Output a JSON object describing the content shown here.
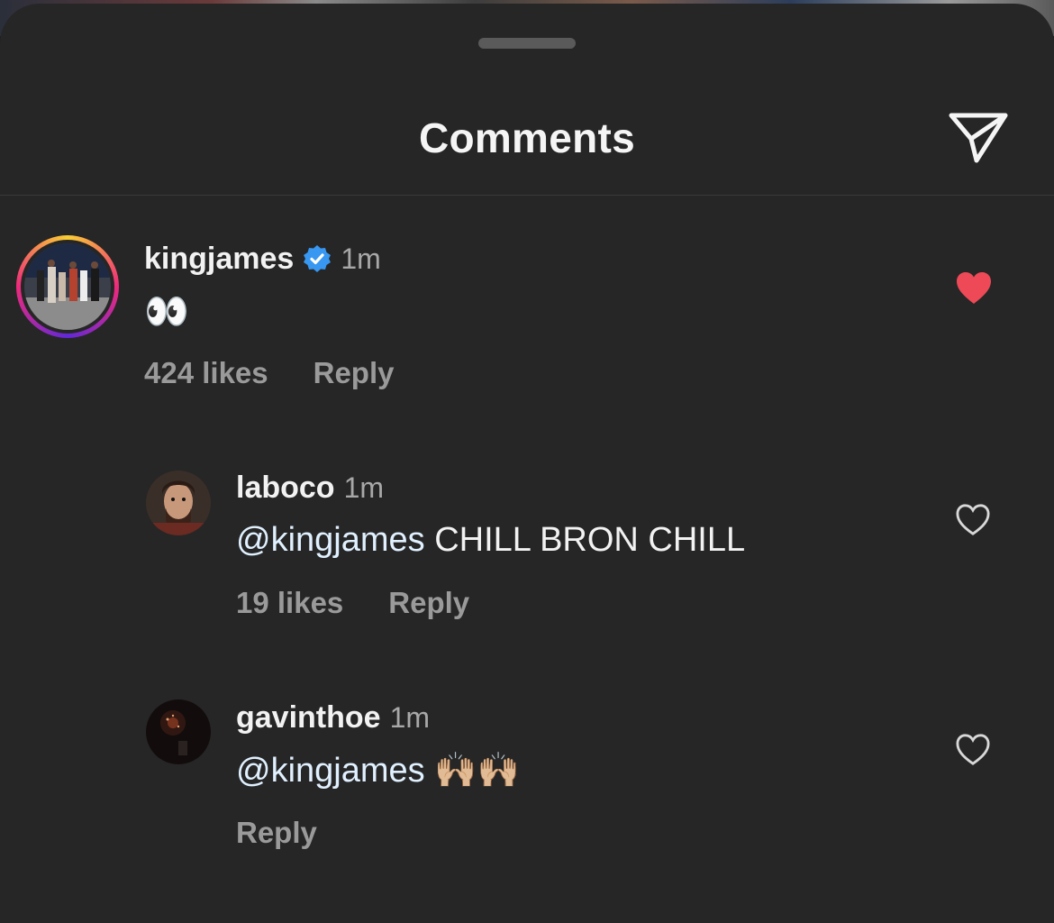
{
  "header": {
    "title": "Comments",
    "share_icon": "paper-plane-icon"
  },
  "colors": {
    "liked": "#ed4956",
    "verified": "#3897f0",
    "mention": "#e0f0ff"
  },
  "comments": [
    {
      "username": "kingjames",
      "verified": true,
      "time": "1m",
      "text": "👀",
      "likes": "424 likes",
      "reply": "Reply",
      "liked": true
    },
    {
      "username": "laboco",
      "verified": false,
      "time": "1m",
      "mention": "@kingjames",
      "text": " CHILL BRON CHILL",
      "likes": "19 likes",
      "reply": "Reply",
      "liked": false
    },
    {
      "username": "gavinthoe",
      "verified": false,
      "time": "1m",
      "mention": "@kingjames",
      "text": " 🙌🏼🙌🏼",
      "reply": "Reply",
      "liked": false
    }
  ]
}
